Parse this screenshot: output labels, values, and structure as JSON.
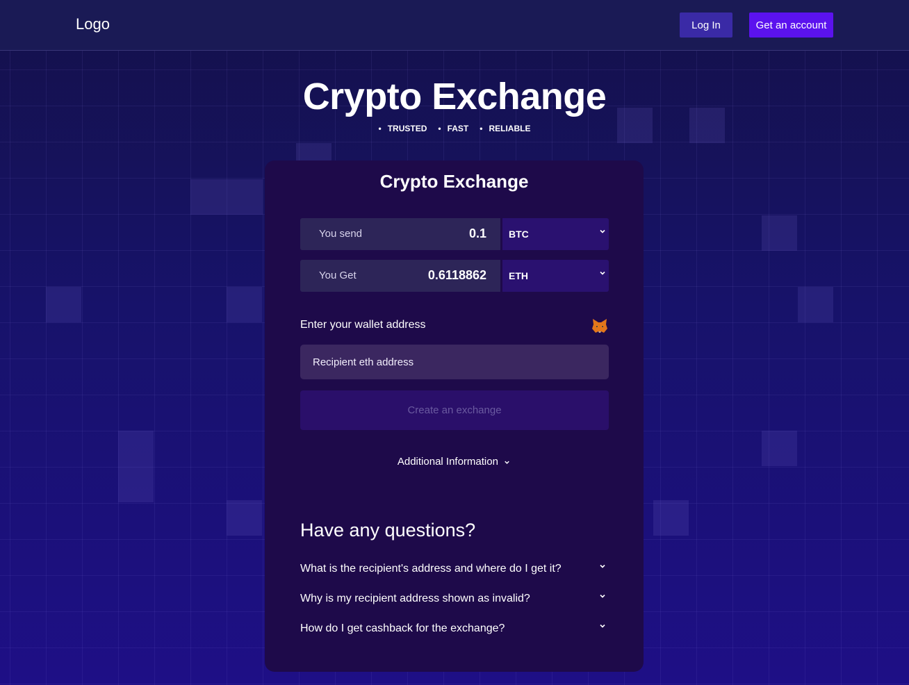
{
  "header": {
    "logo": "Logo",
    "login_label": "Log In",
    "signup_label": "Get an account"
  },
  "hero": {
    "title": "Crypto Exchange",
    "taglines": [
      "TRUSTED",
      "FAST",
      "RELIABLE"
    ]
  },
  "card": {
    "title": "Crypto Exchange",
    "send": {
      "label": "You send",
      "value": "0.1",
      "currency": "BTC"
    },
    "get": {
      "label": "You Get",
      "value": "0.6118862",
      "currency": "ETH"
    },
    "wallet_label": "Enter your wallet address",
    "wallet_icon": "metamask-fox-icon",
    "wallet_placeholder": "Recipient eth address",
    "create_label": "Create an exchange",
    "additional_label": "Additional Information"
  },
  "faq": {
    "title": "Have any questions?",
    "items": [
      "What is the recipient's address and where do I get it?",
      "Why is my recipient address shown as invalid?",
      "How do I get cashback for the exchange?"
    ]
  },
  "colors": {
    "background": "#17126a",
    "card": "#1e0a4a",
    "accent": "#5b12ee",
    "login_button": "#3a2aa6"
  }
}
